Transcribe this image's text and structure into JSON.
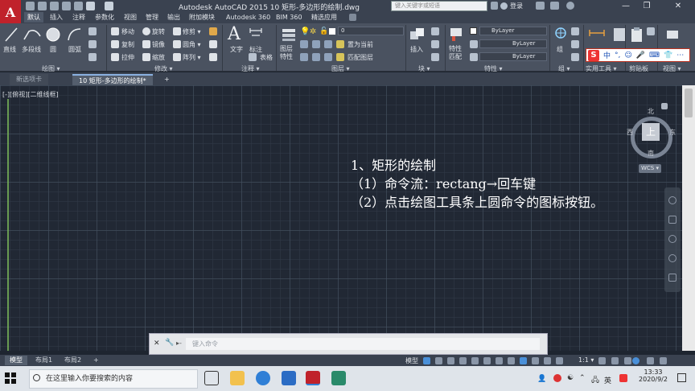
{
  "window": {
    "title": "Autodesk AutoCAD 2015    10 矩形-多边形的绘制.dwg",
    "logo": "A",
    "search_placeholder": "键入关键字或短语",
    "login": "登录",
    "controls": [
      "—",
      "❐",
      "✕"
    ]
  },
  "ribbon_tabs": [
    "默认",
    "插入",
    "注释",
    "参数化",
    "视图",
    "管理",
    "输出",
    "附加模块",
    "Autodesk 360",
    "BIM 360",
    "精选应用"
  ],
  "panels": {
    "draw": {
      "label": "绘图 ▾",
      "tools": [
        "直线",
        "多段线",
        "圆",
        "圆弧"
      ]
    },
    "modify": {
      "label": "修改 ▾",
      "tools": [
        "移动",
        "旋转",
        "修剪 ▾",
        "复制",
        "镜像",
        "圆角 ▾",
        "拉伸",
        "缩放",
        "阵列 ▾"
      ]
    },
    "annotation": {
      "label": "注释 ▾",
      "tools": [
        "文字",
        "标注",
        "表格"
      ]
    },
    "layers": {
      "label": "图层 ▾",
      "tools": [
        "图层特性",
        "置为当前",
        "匹配图层"
      ],
      "layer_value": "0"
    },
    "block": {
      "label": "块 ▾",
      "tools": [
        "插入"
      ]
    },
    "properties": {
      "label": "特性 ▾",
      "tools": [
        "特性匹配"
      ],
      "color": "ByLayer",
      "linetype": "ByLayer",
      "lineweight": "ByLayer"
    },
    "groups": {
      "label": "组 ▾",
      "tools": [
        "组"
      ]
    },
    "utilities": {
      "label": "实用工具 ▾"
    },
    "clipboard": {
      "label": "剪贴板"
    },
    "view": {
      "label": "视图 ▾"
    }
  },
  "ime": {
    "logo": "S",
    "items": [
      "中",
      "°,",
      "☺",
      "🎤",
      "⌨",
      "👕",
      "⋯"
    ]
  },
  "file_tabs": [
    "新选项卡",
    "10 矩形-多边形的绘制*",
    "+"
  ],
  "viewport_label": "[-][俯视][二维线框]",
  "viewcube": {
    "top": "上",
    "north": "北",
    "south": "南",
    "east": "东",
    "west": "西",
    "wcs": "WCS ▾"
  },
  "annotation": {
    "line1": "1、矩形的绘制",
    "line2": "（1）命令流：rectang→回车键",
    "line3": "（2）点击绘图工具条上圆命令的图标按钮。"
  },
  "command": {
    "placeholder": "键入命令",
    "close": "✕",
    "tool": "🔧",
    "prompt": "▸-"
  },
  "layout_tabs": [
    "模型",
    "布局1",
    "布局2",
    "+"
  ],
  "status": {
    "model": "模型",
    "scale": "1:1 ▾"
  },
  "taskbar": {
    "search": "在这里输入你要搜索的内容",
    "ime": "英",
    "time": "13:33",
    "date": "2020/9/2"
  },
  "colors": {
    "canvas": "#212834",
    "ribbon": "#4a5260",
    "title_bar": "#3a4250",
    "accent_red": "#c0222b",
    "annotation_text": "#ffffff"
  }
}
